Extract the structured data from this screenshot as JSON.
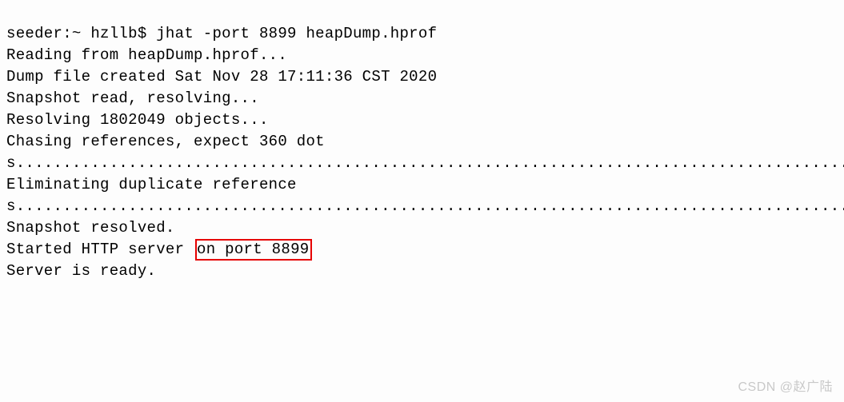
{
  "terminal": {
    "prompt_line": "seeder:~ hzllb$ jhat -port 8899 heapDump.hprof",
    "lines": [
      "Reading from heapDump.hprof...",
      "Dump file created Sat Nov 28 17:11:36 CST 2020",
      "Snapshot read, resolving...",
      "Resolving 1802049 objects...",
      "",
      "",
      "Chasing references, expect 360 dots.......................................................................................................................................................................................................................................................................................................Eliminating duplicate references...............................................................................................................................................................................................................................................................................................................Snapshot resolved."
    ],
    "server_line_prefix": "Started HTTP server ",
    "server_line_highlight": "on port 8899",
    "ready_line": "Server is ready."
  },
  "watermark": "CSDN @赵广陆"
}
